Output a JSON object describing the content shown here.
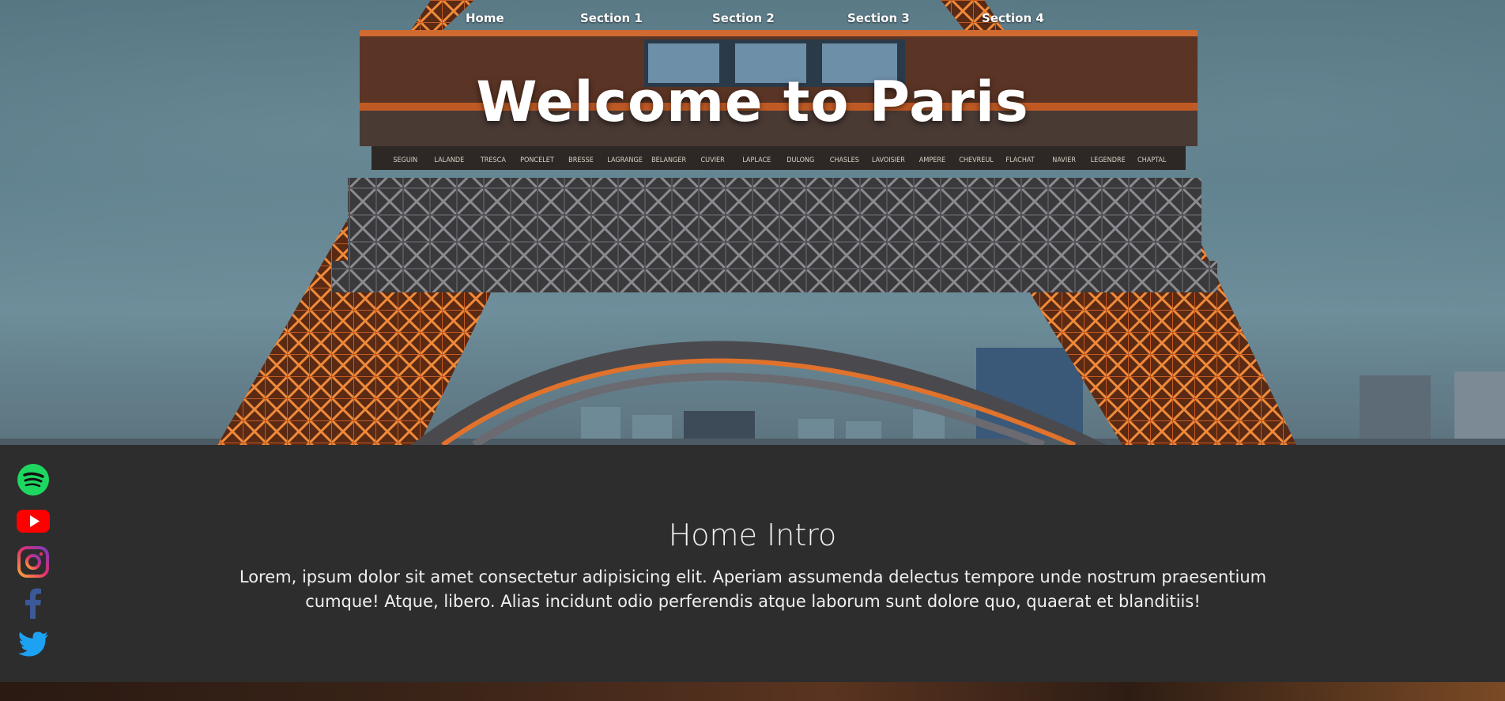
{
  "nav": {
    "items": [
      {
        "label": "Home"
      },
      {
        "label": "Section 1"
      },
      {
        "label": "Section 2"
      },
      {
        "label": "Section 3"
      },
      {
        "label": "Section 4"
      }
    ]
  },
  "hero": {
    "title": "Welcome to Paris",
    "plaque_names": [
      "SEGUIN",
      "LALANDE",
      "TRESCA",
      "PONCELET",
      "BRESSE",
      "LAGRANGE",
      "BELANGER",
      "CUVIER",
      "LAPLACE",
      "DULONG",
      "CHASLES",
      "LAVOISIER",
      "AMPERE",
      "CHEVREUL",
      "FLACHAT",
      "NAVIER",
      "LEGENDRE",
      "CHAPTAL"
    ]
  },
  "intro": {
    "title": "Home Intro",
    "text": "Lorem, ipsum dolor sit amet consectetur adipisicing elit. Aperiam assumenda delectus tempore unde nostrum praesentium cumque! Atque, libero. Alias incidunt odio perferendis atque laborum sunt dolore quo, quaerat et blanditiis!"
  },
  "social": {
    "icons": [
      "spotify-icon",
      "youtube-icon",
      "instagram-icon",
      "facebook-icon",
      "twitter-icon"
    ],
    "colors": {
      "spotify": "#1ed760",
      "youtube": "#ff0000",
      "instagram": "#e1306c",
      "facebook": "#3b5998",
      "twitter": "#1da1f2"
    }
  },
  "colors": {
    "content_bg": "#2d2d2d",
    "text": "#ffffff",
    "sky": "#557784",
    "tower_glow": "#e0722c"
  }
}
